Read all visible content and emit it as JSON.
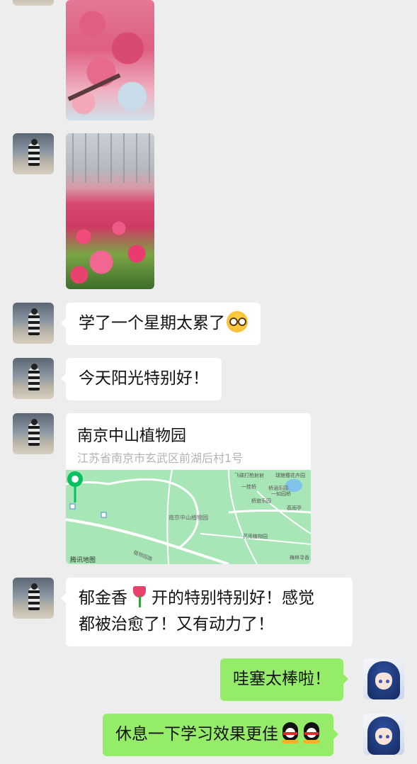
{
  "chat": {
    "messages": [
      {
        "id": "m1",
        "type": "image",
        "sender": "friend",
        "photo": "cherry-blossom"
      },
      {
        "id": "m2",
        "type": "image",
        "sender": "friend",
        "photo": "tulip-field"
      },
      {
        "id": "m3",
        "type": "text",
        "sender": "friend",
        "text": "学了一个星期太累了",
        "emoji": "crying-face"
      },
      {
        "id": "m4",
        "type": "text",
        "sender": "friend",
        "text": "今天阳光特别好！"
      },
      {
        "id": "m5",
        "type": "location",
        "sender": "friend",
        "title": "南京中山植物园",
        "address": "江苏省南京市玄武区前湖后村1号",
        "map": {
          "attribution": "腾讯地图",
          "labels": {
            "poi_center": "南京中山植物园",
            "a": "飞碟打枪射射",
            "b": "球館樱花卉园",
            "c": "一桂桥",
            "d": "桥涵乐园",
            "e": "一如园桥",
            "f": "桥旅乐园",
            "g": "荔雨亭",
            "h": "药用植物园",
            "i": "梅林寻香",
            "j": "植物园路"
          }
        }
      },
      {
        "id": "m6",
        "type": "text",
        "sender": "friend",
        "line1_a": "郁金香",
        "line1_b": "开的特别特别好！感觉",
        "line2": "都被治愈了！又有动力了！"
      },
      {
        "id": "m7",
        "type": "text",
        "sender": "me",
        "text": "哇塞太棒啦！"
      },
      {
        "id": "m8",
        "type": "text",
        "sender": "me",
        "text": "休息一下学习效果更佳"
      }
    ]
  },
  "colors": {
    "background": "#ededed",
    "incoming_bubble": "#ffffff",
    "outgoing_bubble": "#95ec69",
    "map_green": "#a8e6b7",
    "pin": "#07c160"
  }
}
